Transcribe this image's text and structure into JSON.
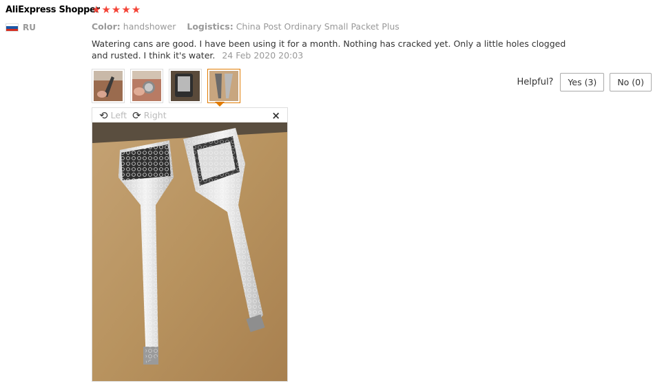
{
  "review": {
    "user_name": "AliExpress Shopper",
    "rating": 5,
    "country_code": "RU",
    "color_label": "Color:",
    "color_value": "handshower",
    "logistics_label": "Logistics:",
    "logistics_value": "China Post Ordinary Small Packet Plus",
    "text": "Watering cans are good. I have been using it for a month. Nothing has cracked yet. Only a little holes clogged and rusted. I think it's water.",
    "date": "24 Feb 2020 20:03"
  },
  "helpful": {
    "label": "Helpful?",
    "yes_label": "Yes (3)",
    "no_label": "No (0)"
  },
  "viewer": {
    "rotate_left_label": "Left",
    "rotate_right_label": "Right",
    "close_glyph": "×"
  },
  "thumbnails": [
    "photo-1",
    "photo-2",
    "photo-3",
    "photo-4"
  ],
  "selected_thumbnail": 4,
  "colors": {
    "star": "#f44336",
    "active_border": "#e07a00"
  }
}
